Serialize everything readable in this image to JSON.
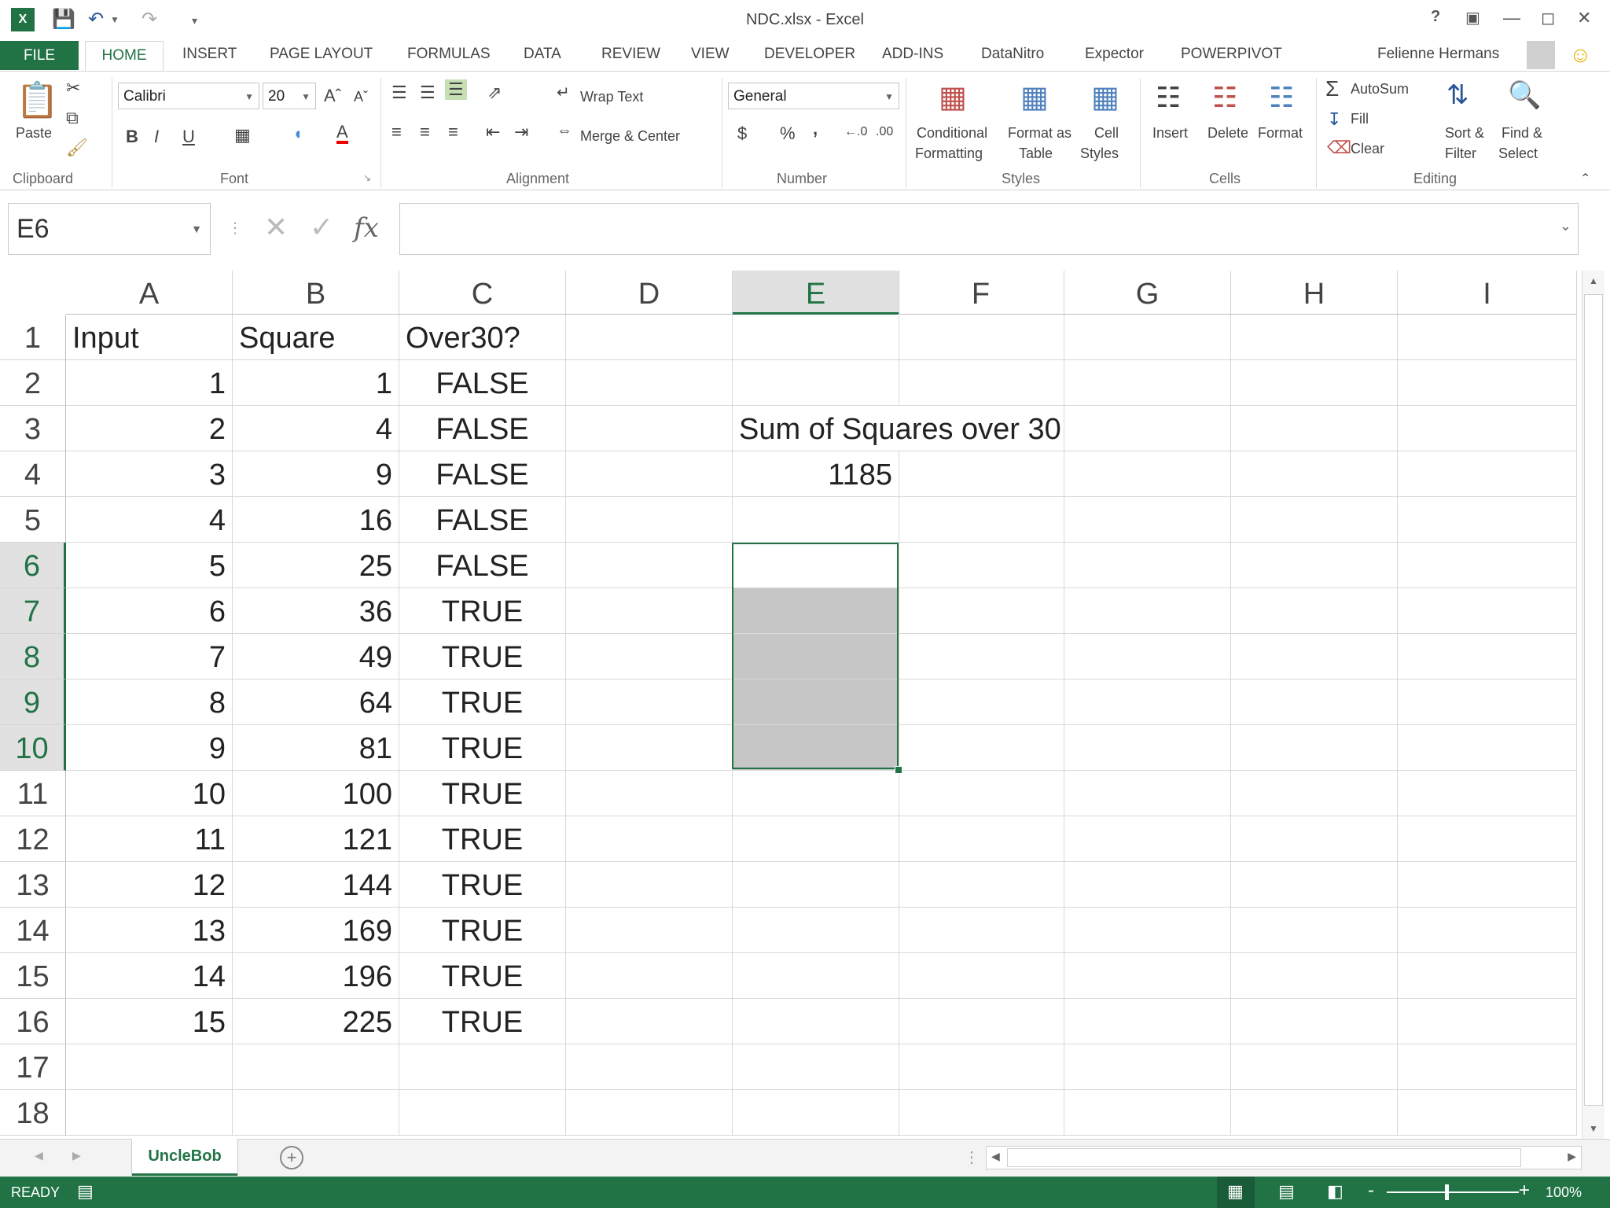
{
  "window": {
    "title": "NDC.xlsx - Excel",
    "help": "?",
    "user": "Felienne Hermans"
  },
  "tabs": [
    "FILE",
    "HOME",
    "INSERT",
    "PAGE LAYOUT",
    "FORMULAS",
    "DATA",
    "REVIEW",
    "VIEW",
    "DEVELOPER",
    "ADD-INS",
    "DataNitro",
    "Expector",
    "POWERPIVOT"
  ],
  "ribbon": {
    "clipboard": {
      "paste": "Paste",
      "group": "Clipboard"
    },
    "font": {
      "name": "Calibri",
      "size": "20",
      "group": "Font",
      "bold": "B",
      "italic": "I",
      "underline": "U"
    },
    "alignment": {
      "wrap": "Wrap Text",
      "merge": "Merge & Center",
      "group": "Alignment"
    },
    "number": {
      "format": "General",
      "currency": "$",
      "percent": "%",
      "comma": ",",
      "group": "Number"
    },
    "styles": {
      "cond1": "Conditional",
      "cond2": "Formatting",
      "fmt1": "Format as",
      "fmt2": "Table",
      "cell1": "Cell",
      "cell2": "Styles",
      "group": "Styles"
    },
    "cells": {
      "insert": "Insert",
      "delete": "Delete",
      "format": "Format",
      "group": "Cells"
    },
    "editing": {
      "autosum": "AutoSum",
      "fill": "Fill",
      "clear": "Clear",
      "sort1": "Sort &",
      "sort2": "Filter",
      "find1": "Find &",
      "find2": "Select",
      "group": "Editing"
    }
  },
  "formula_bar": {
    "name_box": "E6",
    "fx": "fx",
    "value": ""
  },
  "columns": [
    "A",
    "B",
    "C",
    "D",
    "E",
    "F",
    "G",
    "H",
    "I"
  ],
  "rows": [
    "1",
    "2",
    "3",
    "4",
    "5",
    "6",
    "7",
    "8",
    "9",
    "10",
    "11",
    "12",
    "13",
    "14",
    "15",
    "16",
    "17",
    "18"
  ],
  "cells": {
    "A1": "Input",
    "B1": "Square",
    "C1": "Over30?",
    "A": [
      "1",
      "2",
      "3",
      "4",
      "5",
      "6",
      "7",
      "8",
      "9",
      "10",
      "11",
      "12",
      "13",
      "14",
      "15"
    ],
    "B": [
      "1",
      "4",
      "9",
      "16",
      "25",
      "36",
      "49",
      "64",
      "81",
      "100",
      "121",
      "144",
      "169",
      "196",
      "225"
    ],
    "C": [
      "FALSE",
      "FALSE",
      "FALSE",
      "FALSE",
      "FALSE",
      "TRUE",
      "TRUE",
      "TRUE",
      "TRUE",
      "TRUE",
      "TRUE",
      "TRUE",
      "TRUE",
      "TRUE",
      "TRUE"
    ],
    "E3": "Sum of Squares over 30",
    "E4": "1185"
  },
  "sheet_tab": "UncleBob",
  "status": {
    "mode": "READY",
    "zoom": "100%"
  },
  "colors": {
    "accent": "#217346",
    "selection_fill": "#c6c6c6"
  }
}
